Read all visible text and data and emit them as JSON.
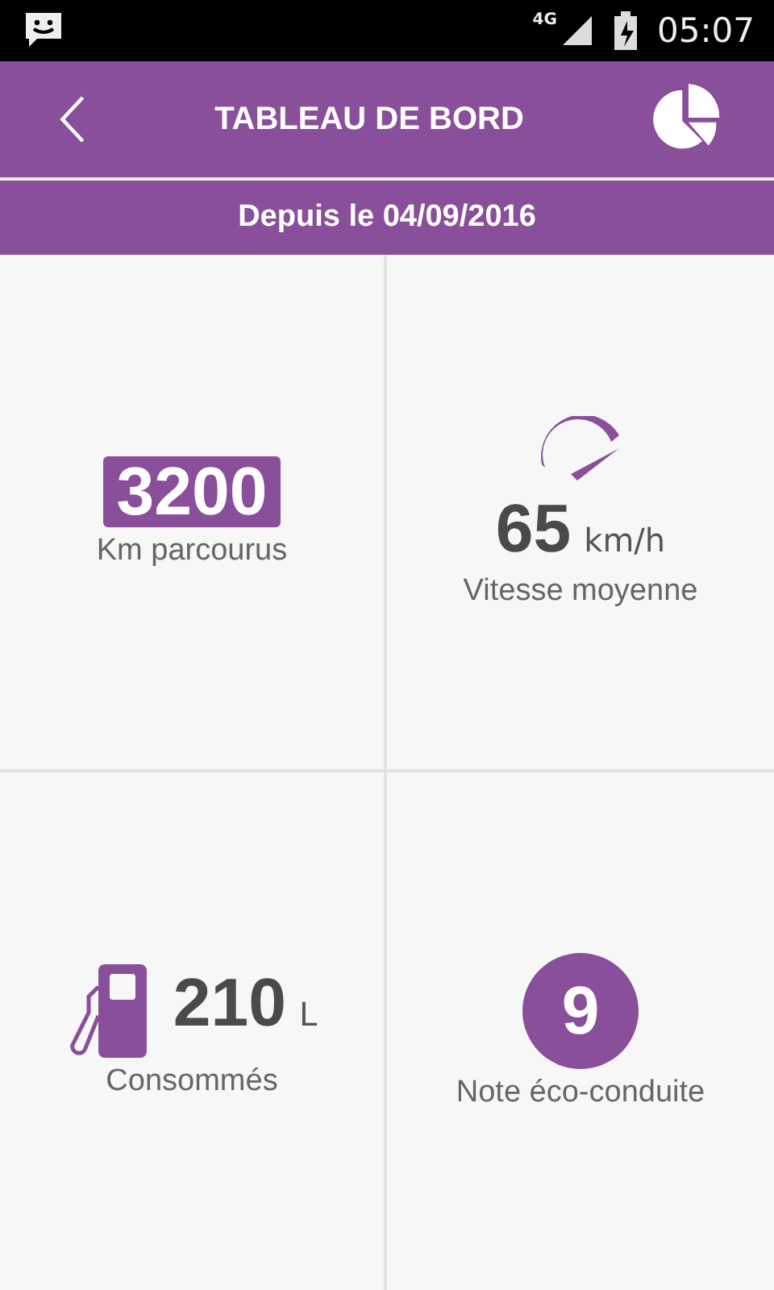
{
  "status_bar": {
    "network": "4G",
    "time": "05:07"
  },
  "header": {
    "title": "TABLEAU DE BORD"
  },
  "period": "Depuis le 04/09/2016",
  "tiles": [
    {
      "kind": "badge",
      "value": "3200",
      "label": "Km parcourus"
    },
    {
      "kind": "gauge",
      "value": "65",
      "unit": "km/h",
      "label": "Vitesse moyenne"
    },
    {
      "kind": "pump",
      "value": "210",
      "unit": "L",
      "label": "Consommés"
    },
    {
      "kind": "circle",
      "value": "9",
      "label": "Note éco-conduite"
    }
  ]
}
